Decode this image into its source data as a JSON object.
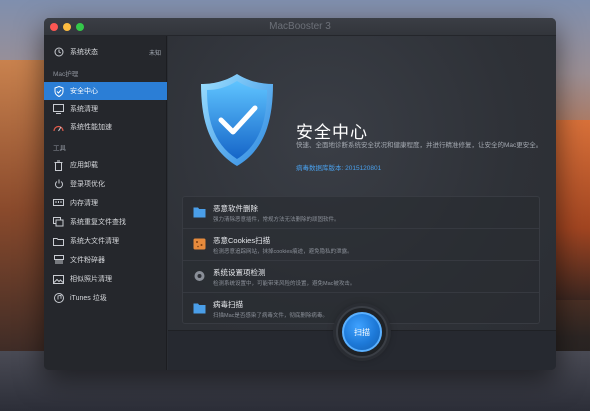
{
  "window": {
    "title": "MacBooster 3"
  },
  "sidebar": {
    "status_label": "系统状态",
    "status_badge": "未知",
    "section_mac": "Mac护理",
    "section_tools": "工具",
    "care_items": [
      {
        "label": "安全中心",
        "icon": "shield-icon",
        "active": true
      },
      {
        "label": "系统清理",
        "icon": "monitor-icon",
        "active": false
      },
      {
        "label": "系统性能加速",
        "icon": "speedometer-icon",
        "active": false
      }
    ],
    "tool_items": [
      {
        "label": "应用卸载",
        "icon": "trash-icon"
      },
      {
        "label": "登录项优化",
        "icon": "power-icon"
      },
      {
        "label": "内存清理",
        "icon": "memory-icon"
      },
      {
        "label": "系统重复文件查找",
        "icon": "duplicate-icon"
      },
      {
        "label": "系统大文件清理",
        "icon": "folder-icon"
      },
      {
        "label": "文件粉碎器",
        "icon": "shredder-icon"
      },
      {
        "label": "相似照片清理",
        "icon": "photos-icon"
      },
      {
        "label": "iTunes 垃圾",
        "icon": "music-icon"
      }
    ]
  },
  "hero": {
    "title": "安全中心",
    "description": "快速、全面地诊断系统安全状况和健康程度，并进行精准修复，让安全的Mac更安全。",
    "db_version": "病毒数据库版本: 2015120801"
  },
  "features": [
    {
      "title": "恶意软件删除",
      "desc": "强力清除恶意插件，常规方法无法删除的顽固软件。",
      "icon": "folder-icon",
      "color": "#4a9ee8"
    },
    {
      "title": "恶意Cookies扫描",
      "desc": "检测恶意追踪网站，抹掉cookies痕迹，避免隐私的泄露。",
      "icon": "cookie-icon",
      "color": "#e68a3c"
    },
    {
      "title": "系统设置项检测",
      "desc": "检测系统设置中，可能带来风险的设置，避免Mac被攻击。",
      "icon": "settings-icon",
      "color": "#8a8f98"
    },
    {
      "title": "病毒扫描",
      "desc": "扫描Mac是否感染了病毒文件，彻底删除病毒。",
      "icon": "folder-icon",
      "color": "#4a9ee8"
    }
  ],
  "scan_button": {
    "label": "扫描"
  },
  "colors": {
    "accent": "#2b7ed6",
    "link": "#4aa0ec"
  }
}
